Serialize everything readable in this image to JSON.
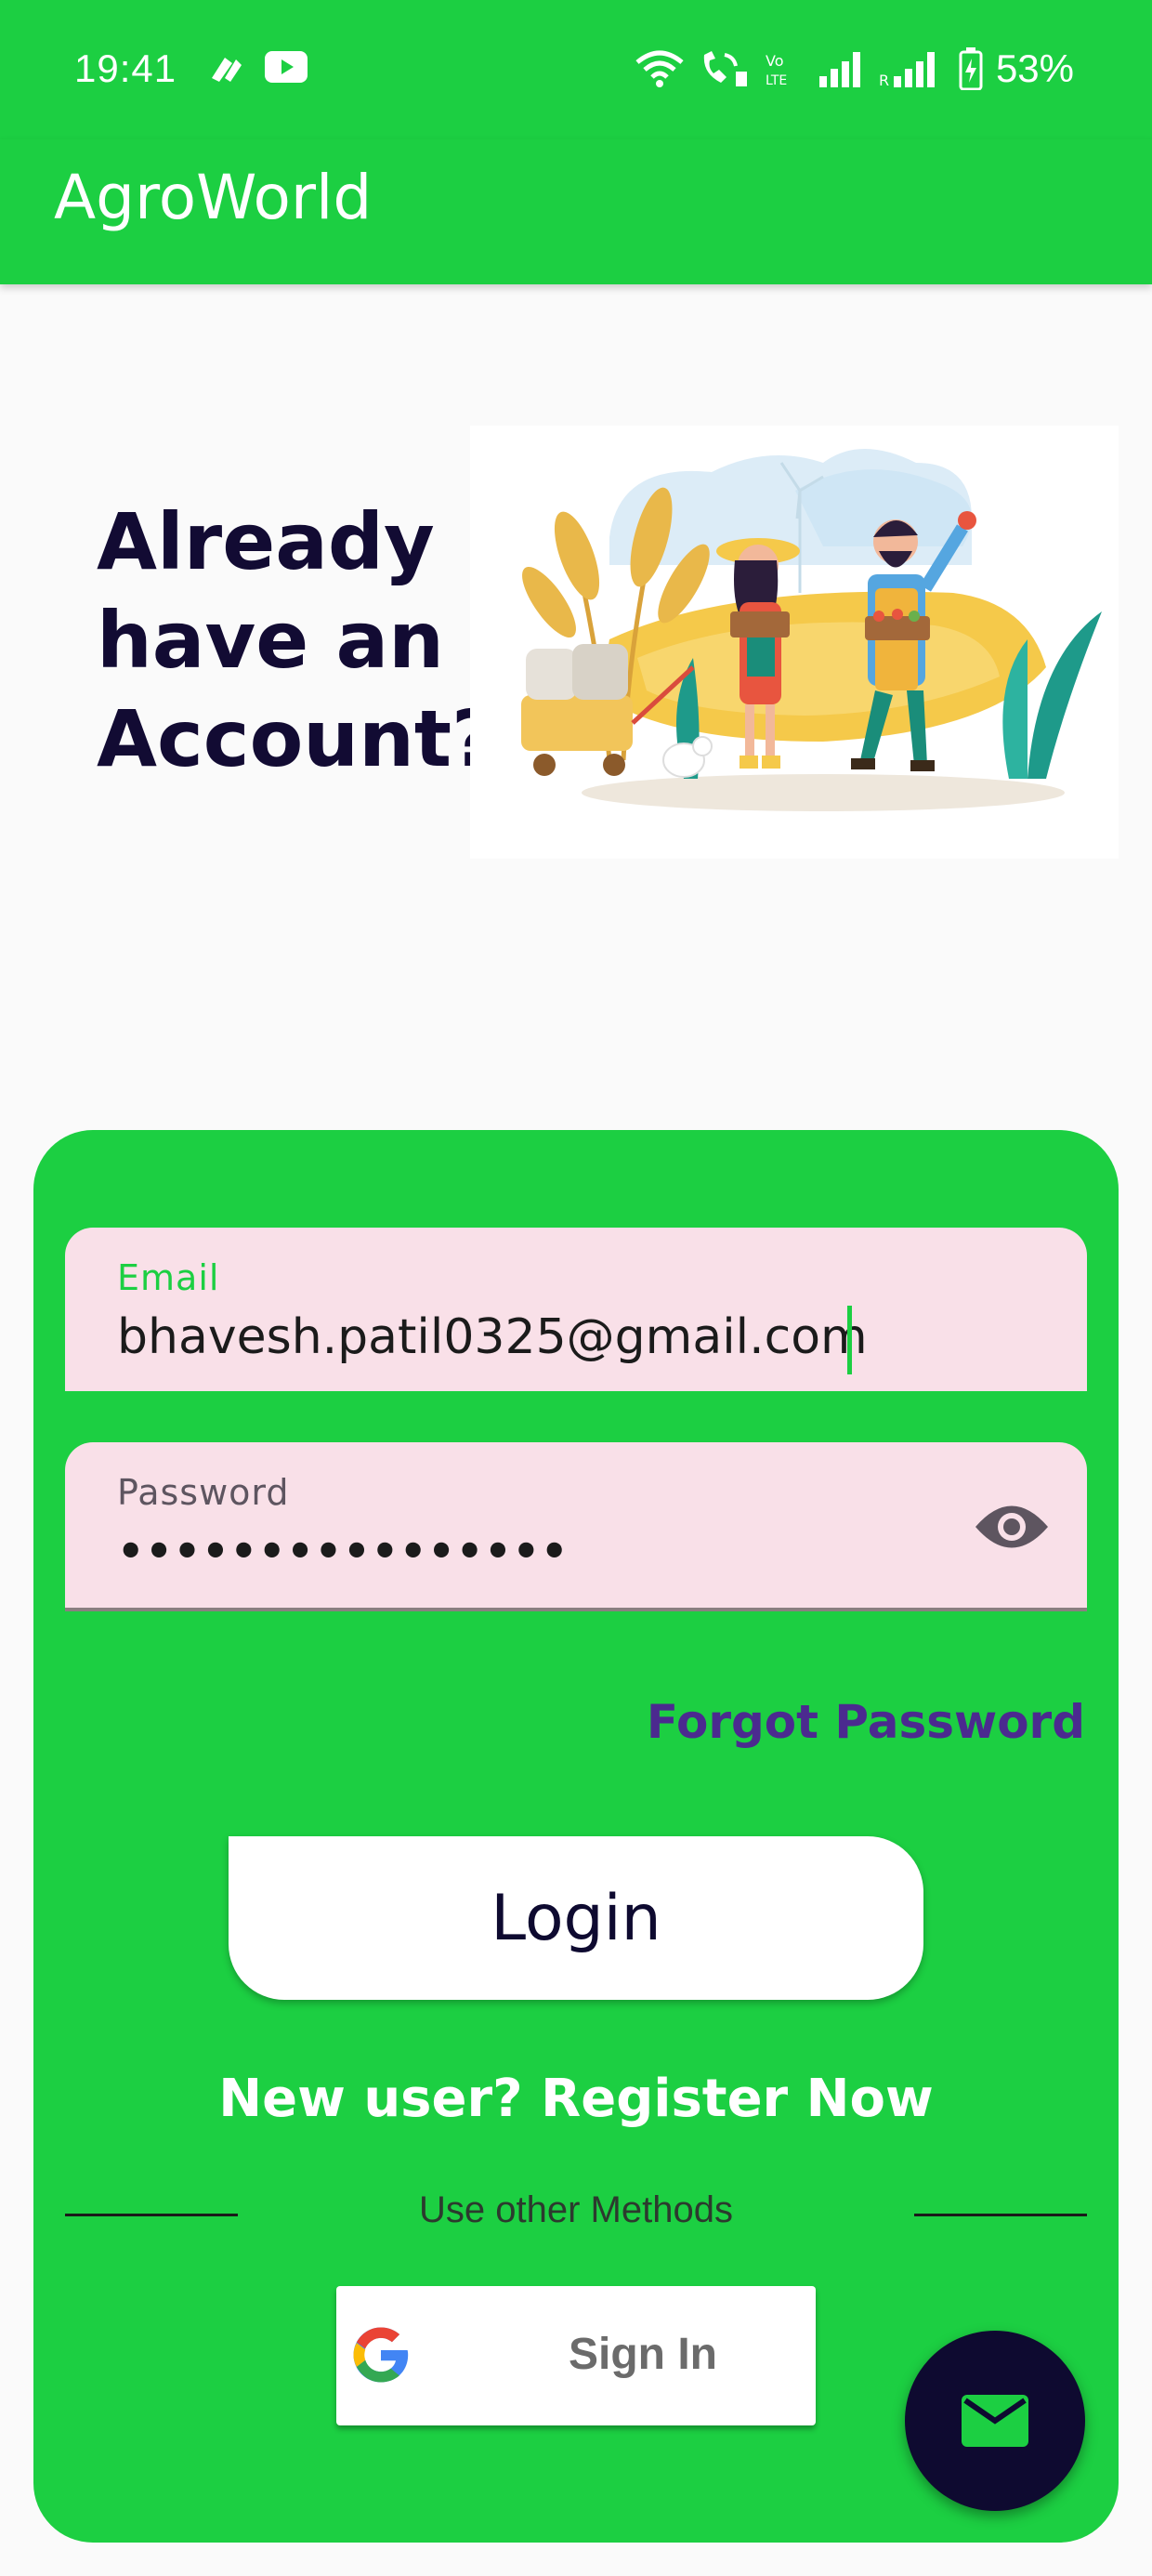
{
  "status_bar": {
    "time": "19:41",
    "battery": "53%",
    "icons": [
      "app-notification-icon",
      "youtube-icon",
      "wifi-icon",
      "wifi-call-icon",
      "volte-icon",
      "signal-icon",
      "signal-roaming-icon",
      "battery-charging-icon"
    ]
  },
  "app_bar": {
    "title": "AgroWorld"
  },
  "hero": {
    "heading": "Already have an Account?"
  },
  "login_form": {
    "email": {
      "label": "Email",
      "value": "bhavesh.patil0325@gmail.com"
    },
    "password": {
      "label": "Password",
      "masked_value": "••••••••••••••••"
    },
    "forgot_password": "Forgot Password",
    "login_label": "Login",
    "register_prompt": "New user? Register Now",
    "other_methods": "Use other Methods",
    "google_sign_in": "Sign In"
  },
  "fab": {
    "icon": "mail-icon"
  },
  "colors": {
    "primary_green": "#1ccf42",
    "dark_navy": "#0e0a30",
    "field_pink": "#f9e0e8",
    "link_purple": "#4b2a8f"
  }
}
